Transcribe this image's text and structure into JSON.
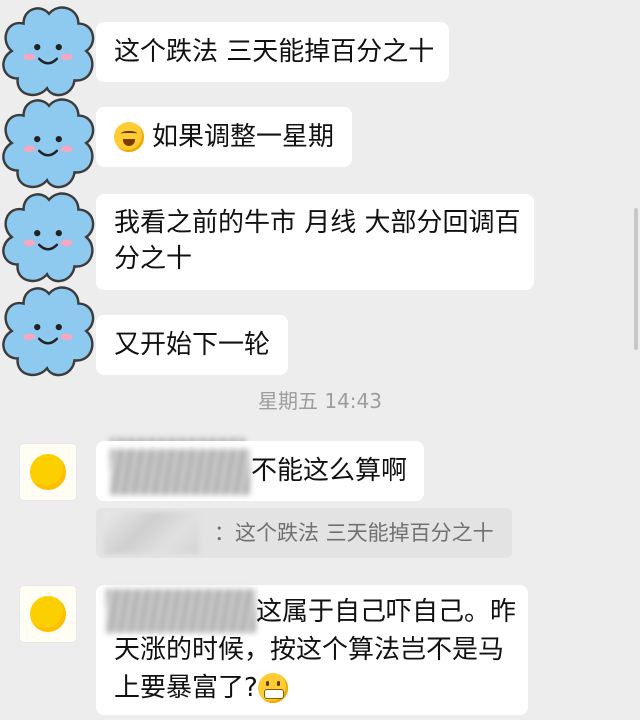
{
  "messages": [
    {
      "text": "这个跌法 三天能掉百分之十"
    },
    {
      "emoji": "sweat-smile-emoji",
      "text": "如果调整一星期"
    },
    {
      "line1": "我看之前的牛市 月线 大部分回调百",
      "line2": "分之十"
    },
    {
      "text": "又开始下一轮"
    }
  ],
  "time_separator": "星期五 14:43",
  "replies": [
    {
      "text": "不能这么算啊",
      "quote": "：这个跌法 三天能掉百分之十"
    },
    {
      "line1": "这属于自己吓自己。昨",
      "line2": "天涨的时候，按这个算法岂不是马",
      "line3": "上要暴富了?",
      "emoji": "grin-emoji"
    }
  ],
  "colors": {
    "background": "#ededed",
    "bubble": "#ffffff",
    "quote_bg": "#e3e3e3",
    "cloud": "#8ec9f0",
    "yolk": "#fcd000"
  }
}
